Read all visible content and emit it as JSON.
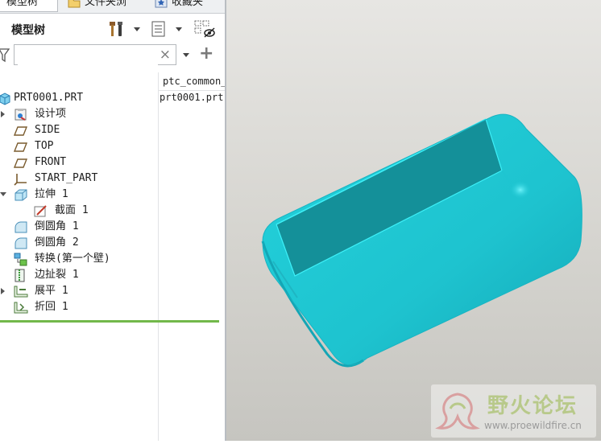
{
  "tabs": [
    {
      "label": "模型树",
      "active": true
    },
    {
      "label": "文件夹浏",
      "active": false
    },
    {
      "label": "收藏夹",
      "active": false
    }
  ],
  "model_tree": {
    "title": "模型树",
    "search": {
      "value": "",
      "placeholder": ""
    },
    "column_header": "ptc_common_name",
    "column_value": "prt0001.prt",
    "items": [
      {
        "label": "PRT0001.PRT",
        "icon": "part-icon",
        "indent": 0,
        "expander": "none"
      },
      {
        "label": "设计项",
        "icon": "design-items-icon",
        "indent": 1,
        "expander": "collapsed"
      },
      {
        "label": "SIDE",
        "icon": "datum-plane-icon",
        "indent": 1,
        "expander": "none"
      },
      {
        "label": "TOP",
        "icon": "datum-plane-icon",
        "indent": 1,
        "expander": "none"
      },
      {
        "label": "FRONT",
        "icon": "datum-plane-icon",
        "indent": 1,
        "expander": "none"
      },
      {
        "label": "START_PART",
        "icon": "coordinate-system-icon",
        "indent": 1,
        "expander": "none"
      },
      {
        "label": "拉伸 1",
        "icon": "extrude-icon",
        "indent": 1,
        "expander": "expanded"
      },
      {
        "label": "截面 1",
        "icon": "sketch-icon",
        "indent": 2,
        "expander": "none"
      },
      {
        "label": "倒圆角 1",
        "icon": "round-icon",
        "indent": 1,
        "expander": "none"
      },
      {
        "label": "倒圆角 2",
        "icon": "round-icon",
        "indent": 1,
        "expander": "none"
      },
      {
        "label": "转换(第一个壁)",
        "icon": "convert-to-sheetmetal-icon",
        "indent": 1,
        "expander": "none"
      },
      {
        "label": "边扯裂 1",
        "icon": "edge-rip-icon",
        "indent": 1,
        "expander": "none"
      },
      {
        "label": "展平 1",
        "icon": "unbend-icon",
        "indent": 1,
        "expander": "collapsed"
      },
      {
        "label": "折回 1",
        "icon": "bend-back-icon",
        "indent": 1,
        "expander": "none"
      }
    ]
  },
  "watermark": {
    "title": "野火论坛",
    "url": "www.proewildfire.cn"
  },
  "colors": {
    "model_face": "#22c9d4",
    "model_edge": "#33eef6",
    "insert_line": "#72b84a"
  }
}
